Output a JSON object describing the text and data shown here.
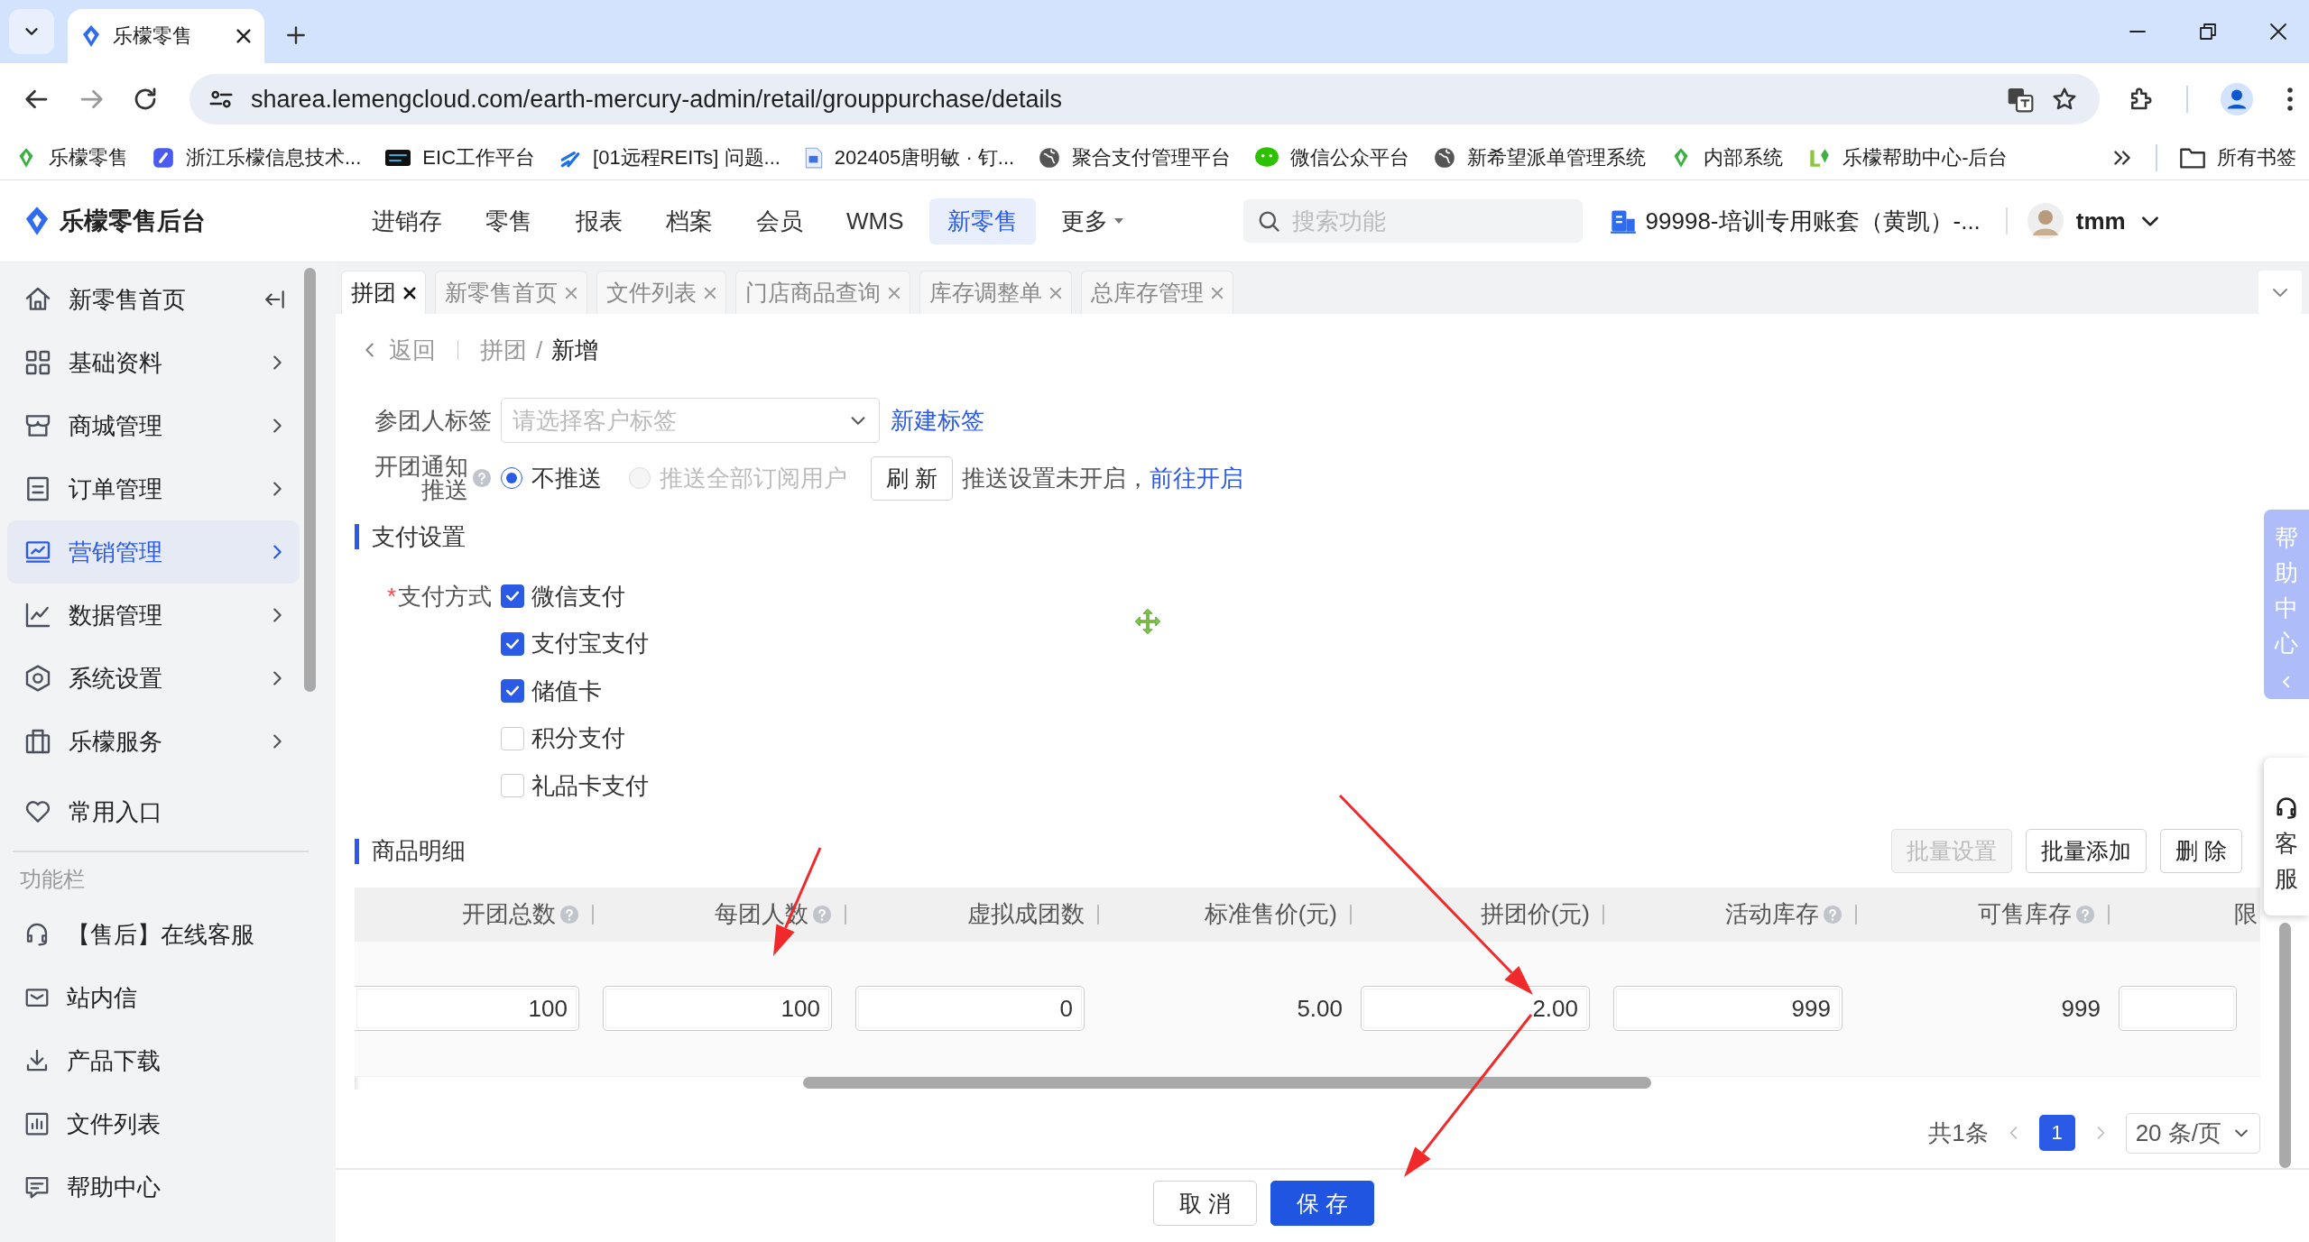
{
  "browser": {
    "tab_title": "乐檬零售",
    "url": "sharea.lemengcloud.com/earth-mercury-admin/retail/grouppurchase/details",
    "bookmarks": [
      "乐檬零售",
      "浙江乐檬信息技术...",
      "EIC工作平台",
      "[01远程REITs] 问题...",
      "202405唐明敏 · 钉...",
      "聚合支付管理平台",
      "微信公众平台",
      "新希望派单管理系统",
      "内部系统",
      "乐檬帮助中心-后台"
    ],
    "all_bookmarks": "所有书签"
  },
  "app": {
    "brand": "乐檬零售后台",
    "nav": [
      {
        "label": "进销存",
        "selected": false,
        "dropdown": false
      },
      {
        "label": "零售",
        "selected": false,
        "dropdown": false
      },
      {
        "label": "报表",
        "selected": false,
        "dropdown": false
      },
      {
        "label": "档案",
        "selected": false,
        "dropdown": false
      },
      {
        "label": "会员",
        "selected": false,
        "dropdown": false
      },
      {
        "label": "WMS",
        "selected": false,
        "dropdown": false
      },
      {
        "label": "新零售",
        "selected": true,
        "dropdown": false
      },
      {
        "label": "更多",
        "selected": false,
        "dropdown": true
      }
    ],
    "search": {
      "placeholder": "搜索功能"
    },
    "account": "99998-培训专用账套（黄凯）-...",
    "user": "tmm"
  },
  "sidebar": {
    "items": [
      {
        "label": "新零售首页",
        "selected": false,
        "expandable": false
      },
      {
        "label": "基础资料",
        "selected": false,
        "expandable": true
      },
      {
        "label": "商城管理",
        "selected": false,
        "expandable": true
      },
      {
        "label": "订单管理",
        "selected": false,
        "expandable": true
      },
      {
        "label": "营销管理",
        "selected": true,
        "expandable": true
      },
      {
        "label": "数据管理",
        "selected": false,
        "expandable": true
      },
      {
        "label": "系统设置",
        "selected": false,
        "expandable": true
      },
      {
        "label": "乐檬服务",
        "selected": false,
        "expandable": true
      },
      {
        "label": "常用入口",
        "selected": false,
        "expandable": false
      }
    ],
    "section_label": "功能栏",
    "shortcuts": [
      "【售后】在线客服",
      "站内信",
      "产品下载",
      "文件列表",
      "帮助中心"
    ]
  },
  "page_tabs": [
    {
      "label": "拼团",
      "selected": true
    },
    {
      "label": "新零售首页",
      "selected": false
    },
    {
      "label": "文件列表",
      "selected": false
    },
    {
      "label": "门店商品查询",
      "selected": false
    },
    {
      "label": "库存调整单",
      "selected": false
    },
    {
      "label": "总库存管理",
      "selected": false
    }
  ],
  "breadcrumb": {
    "back": "返回",
    "path": [
      "拼团",
      "新增"
    ],
    "separator": "/"
  },
  "tag_field": {
    "label": "参团人标签",
    "placeholder": "请选择客户标签",
    "link": "新建标签"
  },
  "notify": {
    "label": "开团通知推送",
    "help": true,
    "options": [
      {
        "label": "不推送",
        "selected": true,
        "disabled": false
      },
      {
        "label": "推送全部订阅用户",
        "selected": false,
        "disabled": true
      }
    ],
    "refresh": "刷 新",
    "note": "推送设置未开启，",
    "link": "前往开启"
  },
  "payment": {
    "title": "支付设置",
    "label": "支付方式",
    "required_mark": "*",
    "options": [
      {
        "label": "微信支付",
        "checked": true
      },
      {
        "label": "支付宝支付",
        "checked": true
      },
      {
        "label": "储值卡",
        "checked": true
      },
      {
        "label": "积分支付",
        "checked": false
      },
      {
        "label": "礼品卡支付",
        "checked": false
      }
    ]
  },
  "goods": {
    "title": "商品明细",
    "actions": [
      {
        "label": "批量设置",
        "disabled": true
      },
      {
        "label": "批量添加",
        "disabled": false
      },
      {
        "label": "删 除",
        "disabled": false
      }
    ],
    "columns": [
      {
        "label": "开团总数",
        "help": true
      },
      {
        "label": "每团人数",
        "help": true
      },
      {
        "label": "虚拟成团数",
        "help": false
      },
      {
        "label": "标准售价(元)",
        "help": false
      },
      {
        "label": "拼团价(元)",
        "help": false
      },
      {
        "label": "活动库存",
        "help": true
      },
      {
        "label": "可售库存",
        "help": true
      },
      {
        "label": "限",
        "help": false
      }
    ],
    "rows": [
      {
        "cells": [
          {
            "kind": "input",
            "value": "100"
          },
          {
            "kind": "input",
            "value": "100"
          },
          {
            "kind": "input",
            "value": "0"
          },
          {
            "kind": "text",
            "value": "5.00"
          },
          {
            "kind": "input",
            "value": "2.00"
          },
          {
            "kind": "input",
            "value": "999"
          },
          {
            "kind": "text",
            "value": "999"
          },
          {
            "kind": "input"
          }
        ]
      }
    ],
    "pagination": {
      "total": "共1条",
      "pages": [
        {
          "label": "1",
          "selected": true
        }
      ],
      "page_size": "20 条/页"
    }
  },
  "footer": [
    {
      "label": "取 消",
      "kind": "default"
    },
    {
      "label": "保 存",
      "kind": "primary"
    }
  ],
  "help_panel": {
    "label": "帮助中心"
  },
  "service_panel": {
    "label": "客服"
  }
}
